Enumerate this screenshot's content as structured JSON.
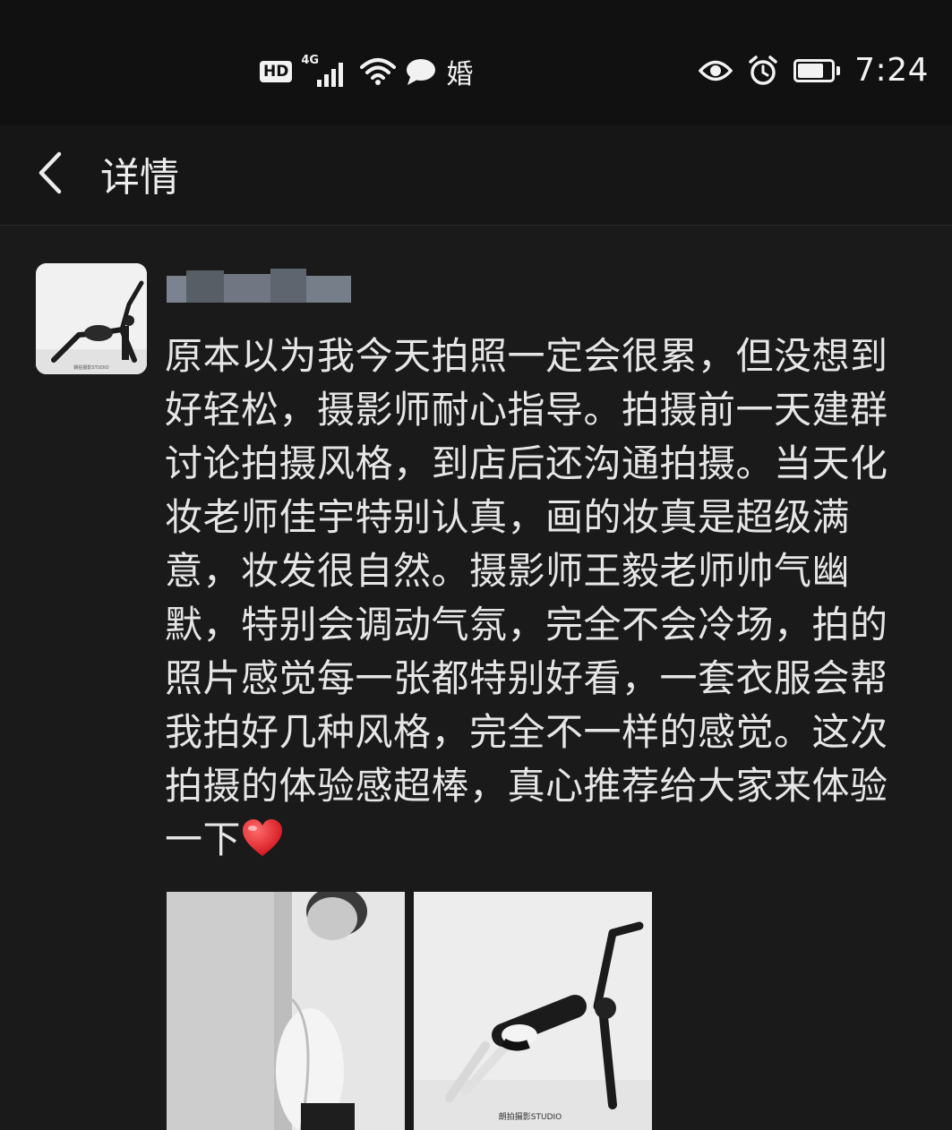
{
  "status_bar": {
    "hd_label": "HD",
    "network_label": "4G",
    "carrier_char": "婚",
    "time": "7:24",
    "icons": [
      "hd-icon",
      "signal-icon",
      "wifi-icon",
      "chat-icon",
      "eye-icon",
      "alarm-icon",
      "battery-icon"
    ]
  },
  "nav": {
    "title": "详情",
    "back_icon": "chevron-left-icon"
  },
  "review": {
    "username": "",
    "text": "原本以为我今天拍照一定会很累，但没想到好轻松，摄影师耐心指导。拍摄前一天建群讨论拍摄风格，到店后还沟通拍摄。当天化妆老师佳宇特别认真，画的妆真是超级满意，妆发很自然。摄影师王毅老师帅气幽默，特别会调动气氛，完全不会冷场，拍的照片感觉每一张都特别好看，一套衣服会帮我拍好几种风格，完全不一样的感觉。这次拍摄的体验感超棒，真心推荐给大家来体验一下",
    "emoji_icon": "heart-icon"
  },
  "avatar": {
    "watermark": "朗拍摄影STUDIO"
  },
  "photos": [
    {
      "watermark": ""
    },
    {
      "watermark": "朗拍摄影STUDIO"
    }
  ]
}
